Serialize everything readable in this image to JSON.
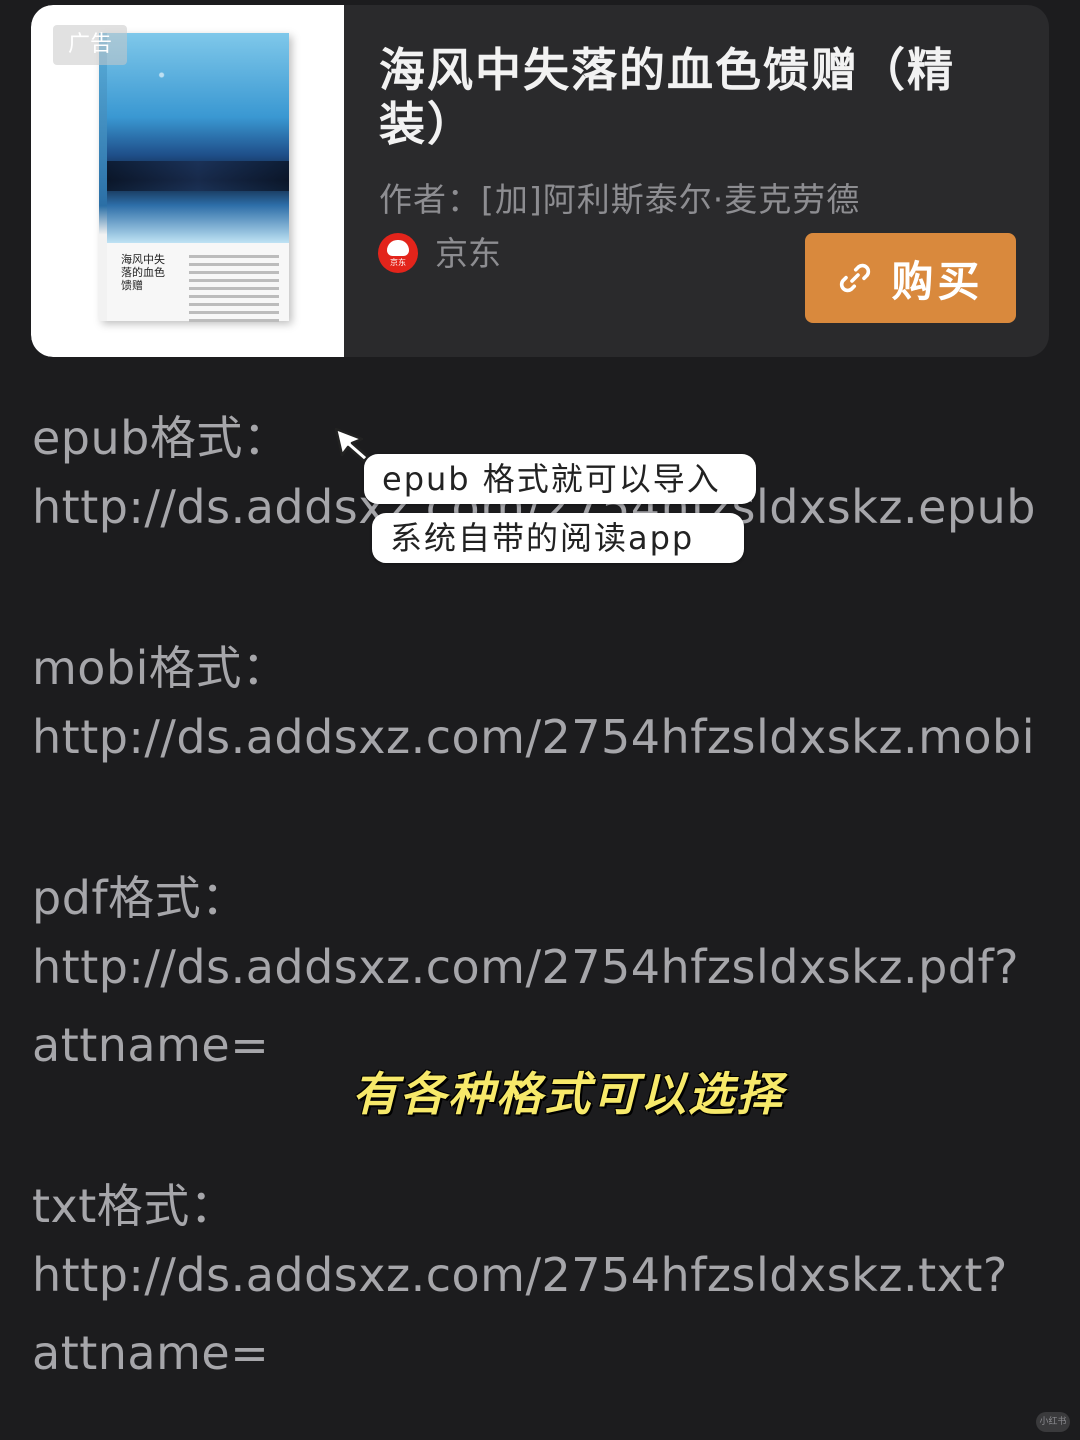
{
  "ad": {
    "badge": "广告",
    "book_cover_title": "海风中失落的血色馈赠",
    "title": "海风中失落的血色馈赠（精装）",
    "author": "作者：[加]阿利斯泰尔·麦克劳德",
    "seller": "京东",
    "seller_logo_text": "京东",
    "buy_label": "购买",
    "accent_color": "#d9893d",
    "seller_color": "#e3241b"
  },
  "formats": [
    {
      "label": "epub格式：",
      "url_lines": [
        "http://ds.addsxz.com/2754hfzsldxskz.epub"
      ]
    },
    {
      "label": "mobi格式：",
      "url_lines": [
        "http://ds.addsxz.com/2754hfzsldxskz.mobi"
      ]
    },
    {
      "label": "pdf格式：",
      "url_lines": [
        "http://ds.addsxz.com/2754hfzsldxskz.pdf?",
        "attname="
      ]
    },
    {
      "label": "txt格式：",
      "url_lines": [
        "http://ds.addsxz.com/2754hfzsldxskz.txt?",
        "attname="
      ]
    }
  ],
  "annotations": {
    "bubble_1": "epub 格式就可以导入",
    "bubble_2": "系统自带的阅读app",
    "caption": "有各种格式可以选择"
  },
  "watermark": "小红书"
}
